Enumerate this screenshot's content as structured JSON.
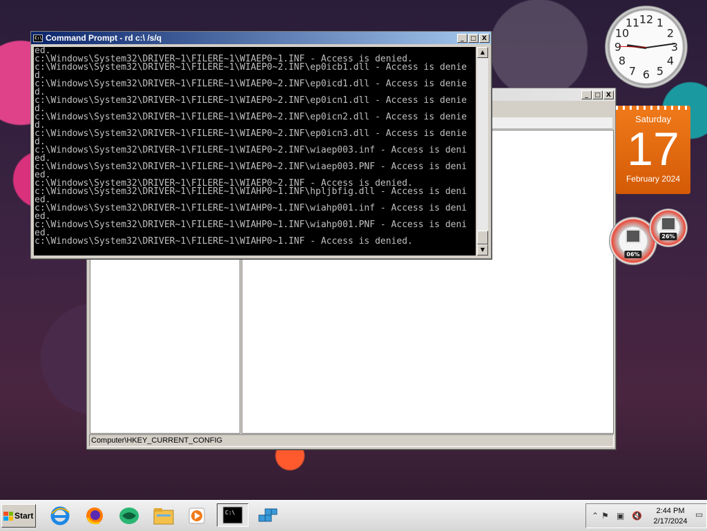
{
  "cmd": {
    "title": "Command Prompt - rd  c:\\ /s/q",
    "buttons": {
      "minimize": "_",
      "maximize": "□",
      "close": "X"
    },
    "lines": [
      "ed.",
      "c:\\Windows\\System32\\DRIVER~1\\FILERE~1\\WIAEP0~1.INF - Access is denied.",
      "c:\\Windows\\System32\\DRIVER~1\\FILERE~1\\WIAEP0~2.INF\\ep0icb1.dll - Access is denie",
      "d.",
      "c:\\Windows\\System32\\DRIVER~1\\FILERE~1\\WIAEP0~2.INF\\ep0icd1.dll - Access is denie",
      "d.",
      "c:\\Windows\\System32\\DRIVER~1\\FILERE~1\\WIAEP0~2.INF\\ep0icn1.dll - Access is denie",
      "d.",
      "c:\\Windows\\System32\\DRIVER~1\\FILERE~1\\WIAEP0~2.INF\\ep0icn2.dll - Access is denie",
      "d.",
      "c:\\Windows\\System32\\DRIVER~1\\FILERE~1\\WIAEP0~2.INF\\ep0icn3.dll - Access is denie",
      "d.",
      "c:\\Windows\\System32\\DRIVER~1\\FILERE~1\\WIAEP0~2.INF\\wiaep003.inf - Access is deni",
      "ed.",
      "c:\\Windows\\System32\\DRIVER~1\\FILERE~1\\WIAEP0~2.INF\\wiaep003.PNF - Access is deni",
      "ed.",
      "c:\\Windows\\System32\\DRIVER~1\\FILERE~1\\WIAEP0~2.INF - Access is denied.",
      "c:\\Windows\\System32\\DRIVER~1\\FILERE~1\\WIAHP0~1.INF\\hpljbfig.dll - Access is deni",
      "ed.",
      "c:\\Windows\\System32\\DRIVER~1\\FILERE~1\\WIAHP0~1.INF\\wiahp001.inf - Access is deni",
      "ed.",
      "c:\\Windows\\System32\\DRIVER~1\\FILERE~1\\WIAHP0~1.INF\\wiahp001.PNF - Access is deni",
      "ed.",
      "c:\\Windows\\System32\\DRIVER~1\\FILERE~1\\WIAHP0~1.INF - Access is denied."
    ]
  },
  "regedit": {
    "status": "Computer\\HKEY_CURRENT_CONFIG",
    "buttons": {
      "minimize": "_",
      "maximize": "□",
      "close": "X"
    }
  },
  "clock": {
    "numbers": [
      "12",
      "1",
      "2",
      "3",
      "4",
      "5",
      "6",
      "7",
      "8",
      "9",
      "10",
      "11"
    ]
  },
  "calendar": {
    "day": "Saturday",
    "date": "17",
    "month": "February 2024"
  },
  "meters": {
    "cpu": "06%",
    "memory": "26%"
  },
  "taskbar": {
    "start_label": "Start",
    "time": "2:44 PM",
    "date": "2/17/2024",
    "apps": [
      "internet-explorer-icon",
      "firefox-icon",
      "app-green-icon",
      "file-explorer-icon",
      "media-player-icon",
      "command-prompt-icon",
      "registry-editor-icon"
    ]
  },
  "colors": {
    "title_active": "#0a246a",
    "calendar": "#f07a1a",
    "console_bg": "#000000",
    "console_fg": "#c0c0c0"
  }
}
